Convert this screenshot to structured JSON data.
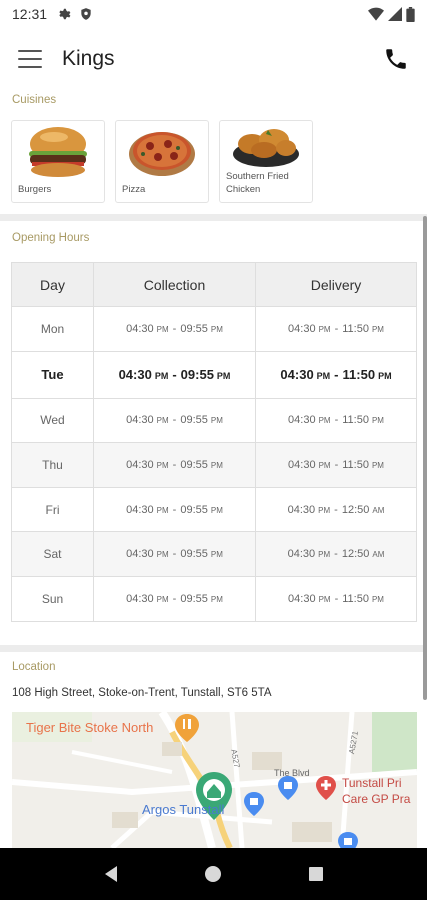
{
  "status": {
    "time": "12:31"
  },
  "app_bar": {
    "title": "Kings"
  },
  "cuisines": {
    "label": "Cuisines",
    "items": [
      {
        "name": "Burgers",
        "icon": "burger-image"
      },
      {
        "name": "Pizza",
        "icon": "pizza-image"
      },
      {
        "name": "Southern Fried Chicken",
        "icon": "fried-chicken-image"
      }
    ]
  },
  "hours": {
    "label": "Opening Hours",
    "headers": [
      "Day",
      "Collection",
      "Delivery"
    ],
    "rows": [
      {
        "day": "Mon",
        "collection_from": "04:30",
        "collection_from_ampm": "PM",
        "collection_to": "09:55",
        "collection_to_ampm": "PM",
        "delivery_from": "04:30",
        "delivery_from_ampm": "PM",
        "delivery_to": "11:50",
        "delivery_to_ampm": "PM"
      },
      {
        "day": "Tue",
        "collection_from": "04:30",
        "collection_from_ampm": "PM",
        "collection_to": "09:55",
        "collection_to_ampm": "PM",
        "delivery_from": "04:30",
        "delivery_from_ampm": "PM",
        "delivery_to": "11:50",
        "delivery_to_ampm": "PM"
      },
      {
        "day": "Wed",
        "collection_from": "04:30",
        "collection_from_ampm": "PM",
        "collection_to": "09:55",
        "collection_to_ampm": "PM",
        "delivery_from": "04:30",
        "delivery_from_ampm": "PM",
        "delivery_to": "11:50",
        "delivery_to_ampm": "PM"
      },
      {
        "day": "Thu",
        "collection_from": "04:30",
        "collection_from_ampm": "PM",
        "collection_to": "09:55",
        "collection_to_ampm": "PM",
        "delivery_from": "04:30",
        "delivery_from_ampm": "PM",
        "delivery_to": "11:50",
        "delivery_to_ampm": "PM"
      },
      {
        "day": "Fri",
        "collection_from": "04:30",
        "collection_from_ampm": "PM",
        "collection_to": "09:55",
        "collection_to_ampm": "PM",
        "delivery_from": "04:30",
        "delivery_from_ampm": "PM",
        "delivery_to": "12:50",
        "delivery_to_ampm": "AM"
      },
      {
        "day": "Sat",
        "collection_from": "04:30",
        "collection_from_ampm": "PM",
        "collection_to": "09:55",
        "collection_to_ampm": "PM",
        "delivery_from": "04:30",
        "delivery_from_ampm": "PM",
        "delivery_to": "12:50",
        "delivery_to_ampm": "AM"
      },
      {
        "day": "Sun",
        "collection_from": "04:30",
        "collection_from_ampm": "PM",
        "collection_to": "09:55",
        "collection_to_ampm": "PM",
        "delivery_from": "04:30",
        "delivery_from_ampm": "PM",
        "delivery_to": "11:50",
        "delivery_to_ampm": "PM"
      }
    ],
    "today_index": 1,
    "separator": "-"
  },
  "location": {
    "label": "Location",
    "address": "108 High Street, Stoke-on-Trent, Tunstall, ST6 5TA",
    "map_labels": {
      "tiger_bite": "Tiger Bite Stoke North",
      "argos": "Argos Tunstall",
      "tunstall_primary": "Tunstall Pri",
      "care_gp": "Care GP Pra",
      "the_blvd": "The Blvd",
      "road_a527": "A527",
      "road_a5271": "A5271"
    }
  },
  "colors": {
    "accent_label": "#a89a64",
    "map_pin": "#3aa876",
    "poi_orange": "#e8734a",
    "poi_blue": "#4a8cf0",
    "poi_red": "#e0504a"
  }
}
